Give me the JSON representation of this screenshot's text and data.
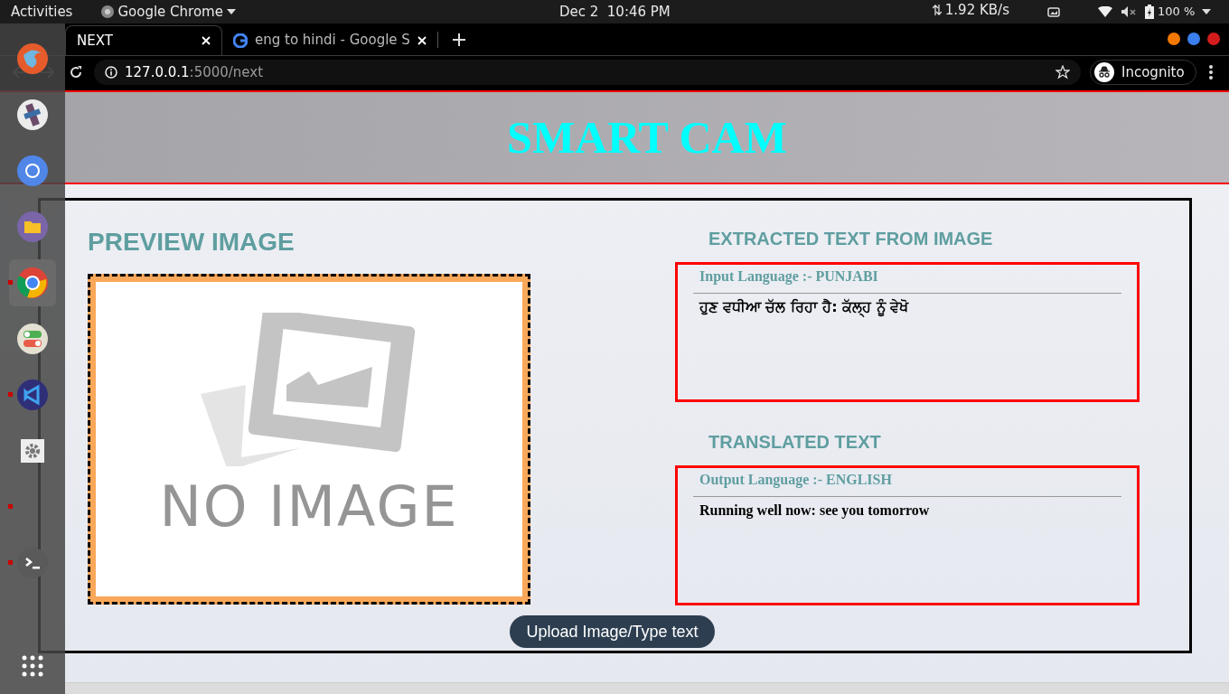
{
  "top_bar": {
    "activities": "Activities",
    "app_menu": "Google Chrome",
    "clock": "Dec 2  10:46 PM",
    "network_speed": "1.92 KB/s",
    "battery": "100 %"
  },
  "tabs": [
    {
      "title": "NEXT",
      "selected": true
    },
    {
      "title": "eng to hindi - Google S",
      "selected": false
    }
  ],
  "address_bar": {
    "host": "127.0.0.1",
    "path": ":5000/next",
    "incognito": "Incognito"
  },
  "dock": [
    {
      "kind": "firefox",
      "running": false,
      "selected": false
    },
    {
      "kind": "video",
      "running": false,
      "selected": false
    },
    {
      "kind": "chromium",
      "running": false,
      "selected": false
    },
    {
      "kind": "files",
      "running": false,
      "selected": false
    },
    {
      "kind": "chrome",
      "running": true,
      "selected": true
    },
    {
      "kind": "toggles",
      "running": false,
      "selected": false
    },
    {
      "kind": "vscode",
      "running": true,
      "selected": false
    },
    {
      "kind": "settings",
      "running": false,
      "selected": false
    },
    {
      "kind": "empty",
      "running": true,
      "selected": false
    },
    {
      "kind": "terminal",
      "running": true,
      "selected": false
    }
  ],
  "page": {
    "title": "SMART CAM",
    "preview_heading": "PREVIEW IMAGE",
    "preview_placeholder": "NO IMAGE",
    "panels": [
      {
        "heading": "EXTRACTED TEXT FROM IMAGE",
        "label": "Input Language :- PUNJABI",
        "text": "ਹੁਣ ਵਧੀਆ ਚੱਲ ਰਿਹਾ ਹੈ: ਕੱਲ੍ਹ ਨੂੰ ਵੇਖੋ"
      },
      {
        "heading": "TRANSLATED TEXT",
        "label": "Output Language :- ENGLISH",
        "text": "Running well now: see you tomorrow"
      }
    ],
    "upload_button": "Upload Image/Type text"
  }
}
